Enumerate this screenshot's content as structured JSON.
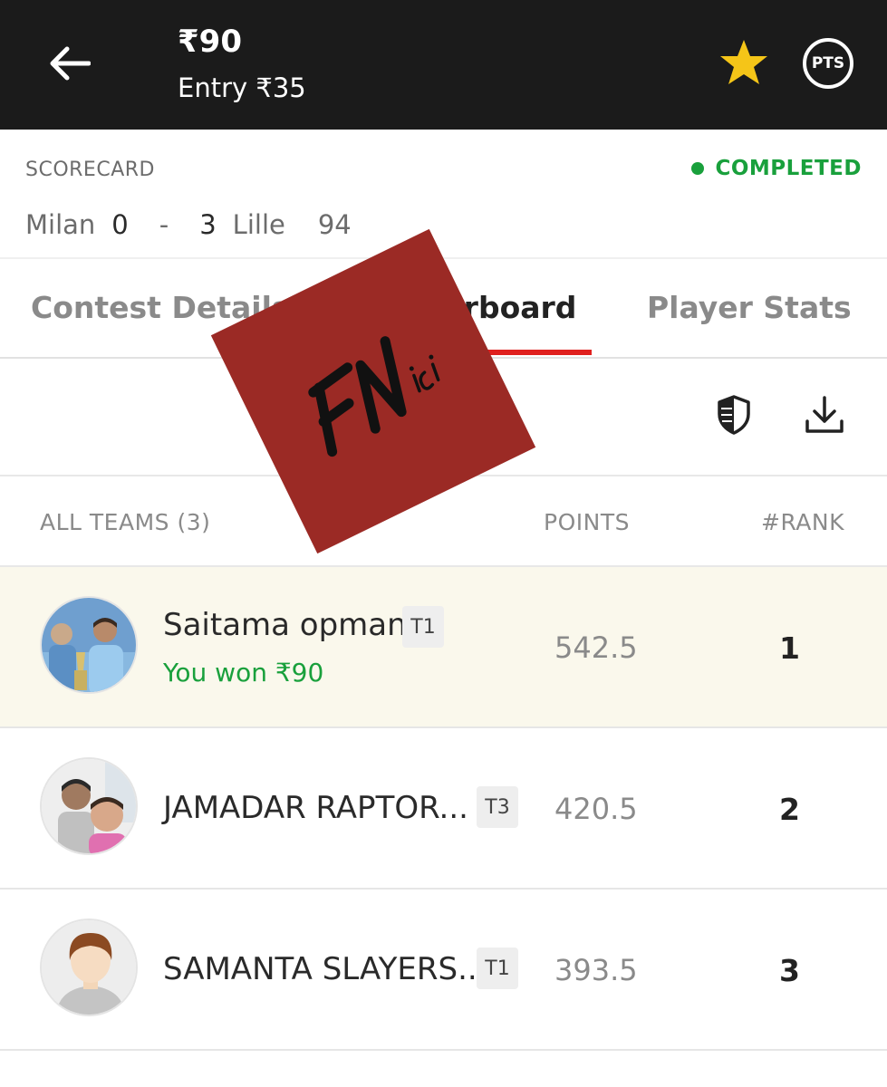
{
  "header": {
    "prize": "₹90",
    "entry": "Entry ₹35",
    "back_icon": "arrow-left-icon",
    "favorite_icon": "star-icon",
    "pts_label": "PTS",
    "star_color": "#f5c518"
  },
  "scorecard": {
    "label": "SCORECARD",
    "status": "COMPLETED",
    "status_color": "#19a03c",
    "home_team": "Milan",
    "home_score": "0",
    "separator": "-",
    "away_score": "3",
    "away_team": "Lille",
    "minute": "94"
  },
  "tabs": [
    {
      "label": "Contest Details",
      "active": false
    },
    {
      "label": "Leaderboard",
      "active": true
    },
    {
      "label": "Player Stats",
      "active": false
    }
  ],
  "toolbar": {
    "compare_icon": "shield-compare-icon",
    "download_icon": "download-icon"
  },
  "columns": {
    "teams": "ALL TEAMS (3)",
    "points": "POINTS",
    "rank": "#RANK"
  },
  "leaderboard": [
    {
      "name": "Saitama opman",
      "tag": "T1",
      "points": "542.5",
      "rank": "1",
      "won": "You won ₹90",
      "highlight": true
    },
    {
      "name": "JAMADAR RAPTOR...",
      "tag": "T3",
      "points": "420.5",
      "rank": "2"
    },
    {
      "name": "SAMANTA SLAYERS...",
      "tag": "T1",
      "points": "393.5",
      "rank": "3"
    }
  ],
  "watermark": {
    "text": "FN",
    "sub": "ici",
    "color": "#9b2a25"
  }
}
